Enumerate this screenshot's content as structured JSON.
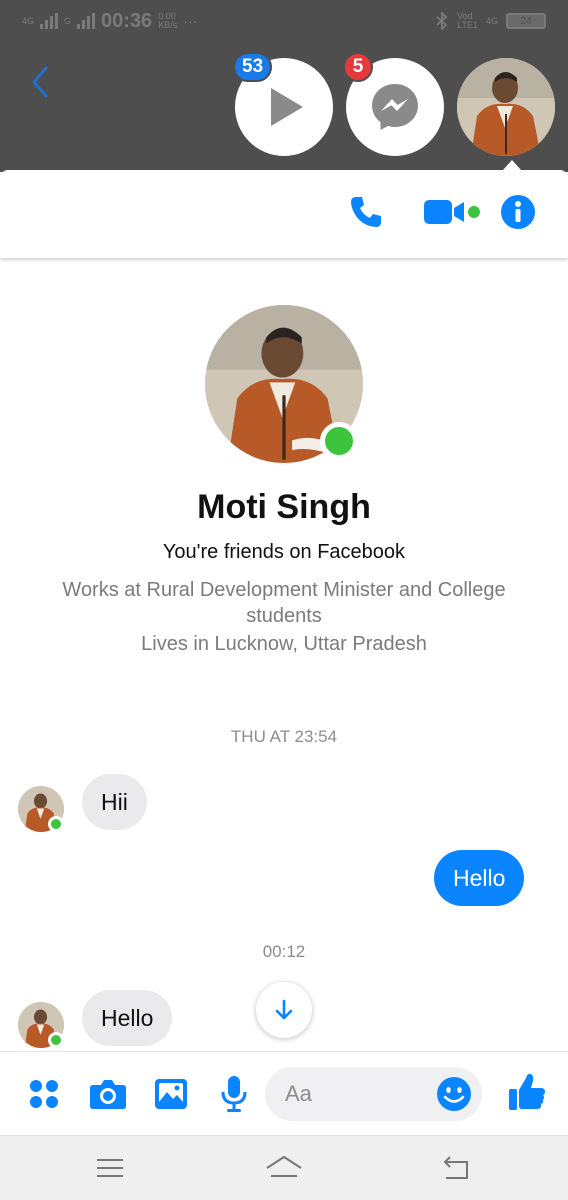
{
  "status_bar": {
    "network_1": "4G",
    "network_2": "G",
    "time": "00:36",
    "speed_value": "0.00",
    "speed_unit": "KB/s",
    "more": "···",
    "carrier_1": "Vod",
    "carrier_2": "LTE1",
    "network_right": "4G",
    "battery": "24"
  },
  "chat_heads": {
    "video_badge": "53",
    "messenger_badge": "5"
  },
  "profile": {
    "name": "Moti Singh",
    "friends_text": "You're friends on Facebook",
    "works_text": "Works at Rural Development Minister and College students",
    "lives_text": "Lives in Lucknow, Uttar Pradesh"
  },
  "conversation": {
    "timestamp_1": "THU AT 23:54",
    "message_1": "Hii",
    "message_2": "Hello",
    "timestamp_2": "00:12",
    "message_3": "Hello"
  },
  "composer": {
    "placeholder": "Aa"
  },
  "colors": {
    "accent": "#0a84ff",
    "online": "#3cc53c",
    "badge_blue": "#1a7ae8",
    "badge_red": "#e6393e"
  },
  "icons": [
    "back-arrow-icon",
    "play-icon",
    "messenger-icon",
    "phone-icon",
    "video-camera-icon",
    "info-icon",
    "arrow-down-icon",
    "more-icon",
    "camera-icon",
    "gallery-icon",
    "microphone-icon",
    "emoji-icon",
    "thumbs-up-icon",
    "menu-icon",
    "home-icon",
    "back-icon"
  ]
}
